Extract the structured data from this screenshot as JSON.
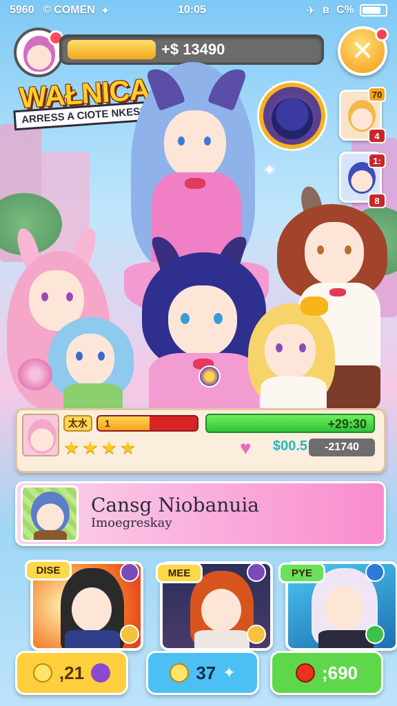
{
  "status_bar": {
    "time_left": "5960",
    "carrier": "© COMEN",
    "clock": "10:05",
    "battery": "C%"
  },
  "top_bar": {
    "currency_value": "+$ 13490",
    "currency_fill_fraction": 0.34
  },
  "logo": {
    "title": "WAŁNICA",
    "subtitle": "ARRESS A CIOTE NKESSERY!"
  },
  "side_portraits": [
    {
      "badge_top": "70",
      "badge_bottom": "4"
    },
    {
      "badge_top": "1:",
      "badge_bottom": "8"
    }
  ],
  "stat_panel": {
    "level_chip": "太水",
    "hp_label": "1",
    "hp_fill_fraction": 0.52,
    "green_value": "+29:30",
    "stars": "★★★★",
    "cash_label": "$00.5",
    "cash_value": "-21740"
  },
  "banner": {
    "title": "Cansg Niobanuia",
    "subtitle": "Imoegreskay"
  },
  "cards": [
    {
      "tag": "DISE",
      "tag_color": "#ffd84a",
      "button_value": ",21",
      "button_color": "#ffcf3d"
    },
    {
      "tag": "MEE",
      "tag_color": "#ffd84a",
      "button_value": "37",
      "button_color": "#4cc0f5"
    },
    {
      "tag": "PYE",
      "tag_color": "#6be05a",
      "button_value": ";690",
      "button_color": "#5ed84a"
    }
  ]
}
